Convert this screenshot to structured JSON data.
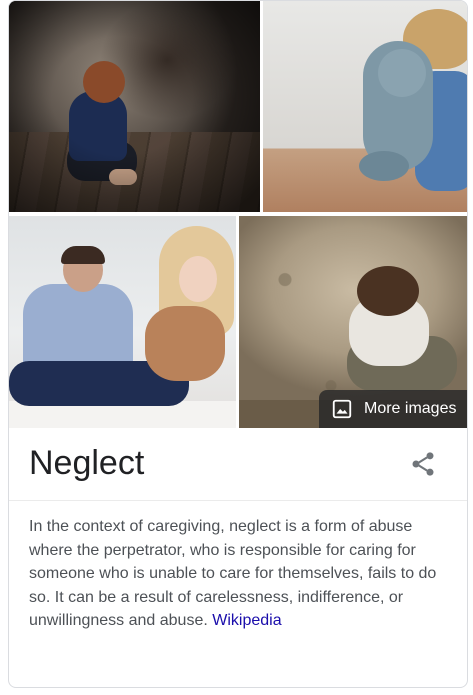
{
  "images": [
    {
      "name": "neglect-image-1"
    },
    {
      "name": "neglect-image-2"
    },
    {
      "name": "neglect-image-3"
    },
    {
      "name": "neglect-image-4"
    }
  ],
  "more_images": {
    "label": "More images",
    "icon": "image-icon"
  },
  "knowledge_panel": {
    "title": "Neglect",
    "share_icon": "share-icon",
    "description": "In the context of caregiving, neglect is a form of abuse where the perpetrator, who is responsible for caring for someone who is unable to care for themselves, fails to do so. It can be a result of carelessness, indifference, or unwillingness and abuse.",
    "source_link": "Wikipedia"
  },
  "colors": {
    "link": "#1a0dab",
    "text": "#4d5156",
    "title": "#202124",
    "overlay": "#202124"
  }
}
